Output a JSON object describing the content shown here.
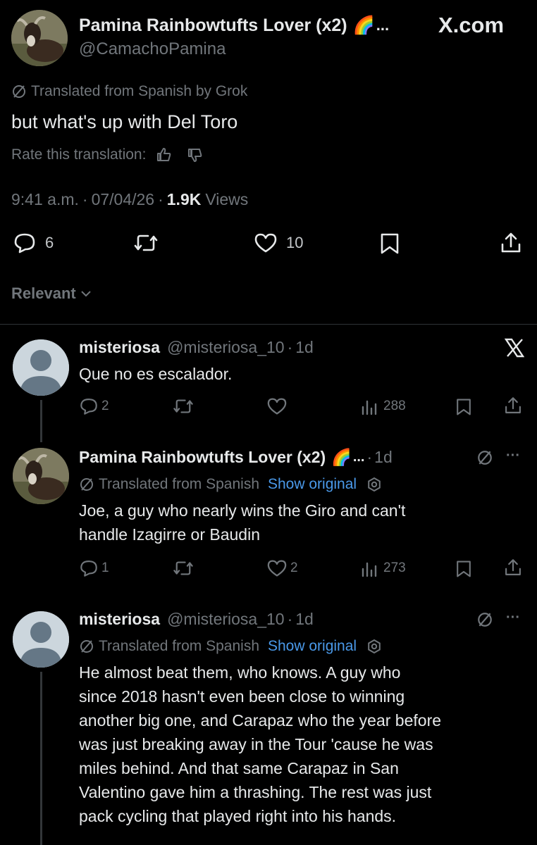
{
  "main_tweet": {
    "display_name": "Pamina Rainbowtufts Lover (x2)",
    "rainbow": "🌈",
    "ellipsis": "...",
    "handle": "@CamachoPamina",
    "brand": "X.com",
    "translated_label": "Translated from Spanish by Grok",
    "text": "but what's up with Del Toro",
    "rate_label": "Rate this translation:",
    "time": "9:41 a.m.",
    "date": "07/04/26",
    "sep": "·",
    "views_count": "1.9K",
    "views_label": "Views",
    "replies": "6",
    "likes": "10"
  },
  "sort": {
    "label": "Relevant"
  },
  "replies": [
    {
      "display_name": "misteriosa",
      "handle": "@misteriosa_10",
      "age": "1d",
      "sep": "·",
      "text": "Que no es escalador.",
      "reply_count": "2",
      "like_count": "",
      "views": "288"
    },
    {
      "display_name": "Pamina Rainbowtufts Lover (x2)",
      "rainbow": "🌈",
      "ellipsis": "...",
      "age": "1d",
      "sep": "·",
      "translated_label": "Translated from Spanish",
      "show_original": "Show original",
      "text_line1": "Joe, a guy who nearly wins the Giro and can't",
      "text_line2": "handle Izagirre or Baudin",
      "reply_count": "1",
      "like_count": "2",
      "views": "273",
      "more": "···"
    },
    {
      "display_name": "misteriosa",
      "handle": "@misteriosa_10",
      "age": "1d",
      "sep": "·",
      "translated_label": "Translated from Spanish",
      "show_original": "Show original",
      "lines": [
        "He almost beat them, who knows. A guy who",
        "since 2018 hasn't even been close to winning",
        "another big one, and Carapaz who the year before",
        "was just breaking away in the Tour 'cause he was",
        "miles behind. And that same Carapaz in San",
        "Valentino gave him a thrashing. The rest was just",
        "pack cycling that played right into his hands."
      ],
      "more": "···"
    }
  ],
  "colors": {
    "background": "#000000",
    "text": "#e7e9ea",
    "secondary": "#71767b",
    "link": "#4a99e9",
    "divider": "#2f3336"
  }
}
